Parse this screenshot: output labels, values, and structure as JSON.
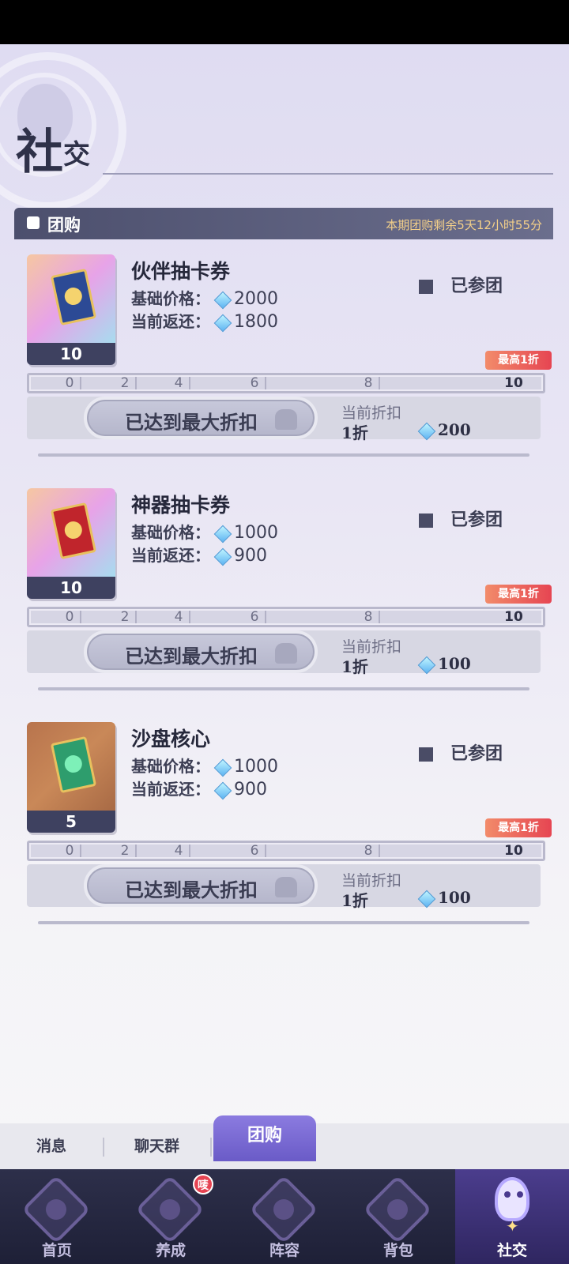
{
  "header": {
    "title_big": "社",
    "title_small": "交"
  },
  "section": {
    "label": "团购",
    "timer": "本期团购剩余5天12小时55分"
  },
  "items": [
    {
      "name": "伙伴抽卡券",
      "qty": "10",
      "base_label": "基础价格：",
      "base_value": "2000",
      "refund_label": "当前返还：",
      "refund_value": "1800",
      "status": "已参团",
      "badge": "最高1折",
      "ticks": [
        "0",
        "2",
        "4",
        "6",
        "8",
        "10"
      ],
      "button": "已达到最大折扣",
      "cur_label": "当前折扣",
      "cur_discount": "1折",
      "cur_gems": "200",
      "thumb_colors": [
        "#f6c7a1",
        "#e7a3e8",
        "#a7dcef"
      ],
      "card_color": "#2c4a95",
      "card_center": "#f5d36e"
    },
    {
      "name": "神器抽卡券",
      "qty": "10",
      "base_label": "基础价格：",
      "base_value": "1000",
      "refund_label": "当前返还：",
      "refund_value": "900",
      "status": "已参团",
      "badge": "最高1折",
      "ticks": [
        "0",
        "2",
        "4",
        "6",
        "8",
        "10"
      ],
      "button": "已达到最大折扣",
      "cur_label": "当前折扣",
      "cur_discount": "1折",
      "cur_gems": "100",
      "thumb_colors": [
        "#f6c7a1",
        "#e7a3e8",
        "#a7dcef"
      ],
      "card_color": "#c0252c",
      "card_center": "#f5d36e"
    },
    {
      "name": "沙盘核心",
      "qty": "5",
      "base_label": "基础价格：",
      "base_value": "1000",
      "refund_label": "当前返还：",
      "refund_value": "900",
      "status": "已参团",
      "badge": "最高1折",
      "ticks": [
        "0",
        "2",
        "4",
        "6",
        "8",
        "10"
      ],
      "button": "已达到最大折扣",
      "cur_label": "当前折扣",
      "cur_discount": "1折",
      "cur_gems": "100",
      "thumb_colors": [
        "#b8744d",
        "#c98858",
        "#a86a45"
      ],
      "card_color": "#2e9d6d",
      "card_center": "#7df0b8"
    }
  ],
  "subtabs": {
    "messages": "消息",
    "chat": "聊天群",
    "group_buy": "团购"
  },
  "nav": {
    "home": "首页",
    "develop": "养成",
    "lineup": "阵容",
    "bag": "背包",
    "social": "社交",
    "develop_badge": "唛"
  },
  "colors": {
    "accent": "#6a5bc7",
    "badge": "#e64552",
    "timer": "#f4d089"
  }
}
